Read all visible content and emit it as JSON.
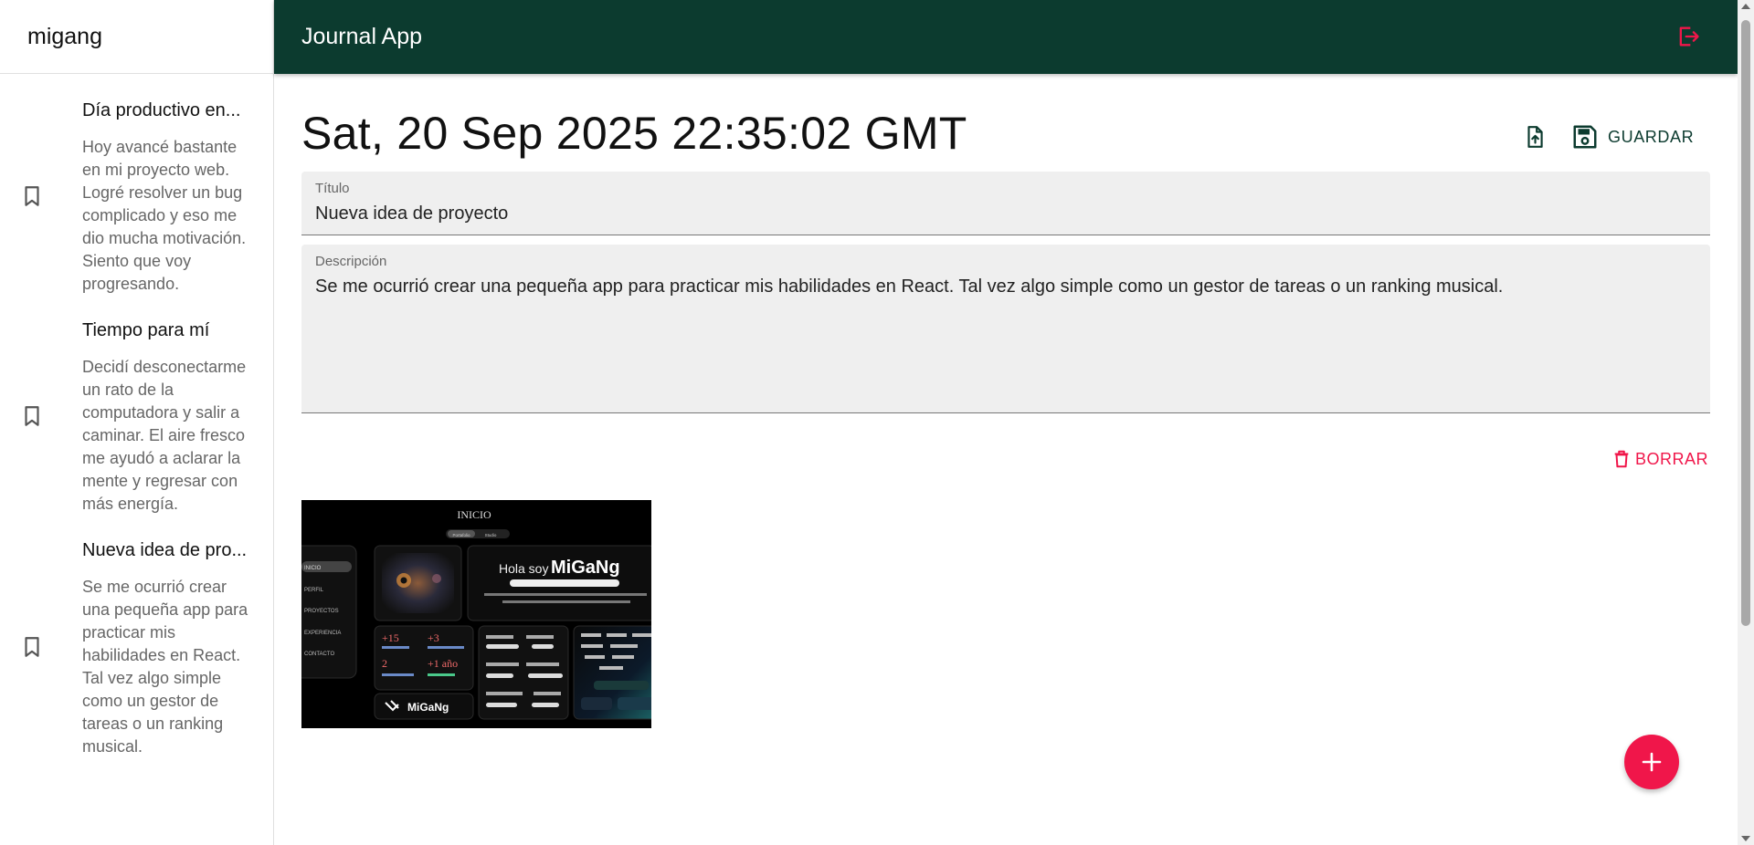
{
  "sidebar": {
    "username": "migang",
    "notes": [
      {
        "title": "Día productivo en...",
        "body": "Hoy avancé bastante en mi proyecto web. Logré resolver un bug complicado y eso me dio mucha motivación. Siento que voy progresando.",
        "icon": "bookmark-icon"
      },
      {
        "title": "Tiempo para mí",
        "body": "Decidí desconectarme un rato de la computadora y salir a caminar. El aire fresco me ayudó a aclarar la mente y regresar con más energía.",
        "icon": "bookmark-icon"
      },
      {
        "title": "Nueva idea de pro...",
        "body": "Se me ocurrió crear una pequeña app para practicar mis habilidades en React. Tal vez algo simple como un gestor de tareas o un ranking musical.",
        "icon": "bookmark-icon"
      }
    ]
  },
  "topbar": {
    "title": "Journal App",
    "logout_icon": "logout-icon"
  },
  "main": {
    "date": "Sat, 20 Sep 2025 22:35:02 GMT",
    "save_label": "GUARDAR",
    "delete_label": "BORRAR",
    "title_field": {
      "label": "Título",
      "value": "Nueva idea de proyecto"
    },
    "description_field": {
      "label": "Descripción",
      "value": "Se me ocurrió crear una pequeña app para practicar mis habilidades en React. Tal vez algo simple como un gestor de tareas o un ranking musical."
    },
    "thumbnail": {
      "heading": "INICIO",
      "tab_1": "Portafolio",
      "tab_2": "Studio",
      "greeting_prefix": "Hola soy",
      "greeting_name": "MiGaNg",
      "menu_items": [
        "INICIO",
        "PERFIL",
        "PROYECTOS",
        "EXPERIENCIA",
        "CONTACTO"
      ],
      "stat_1": "+15",
      "stat_2": "+3",
      "stat_3": "2",
      "stat_4": "+1 año",
      "brand": "MiGaNg"
    }
  },
  "colors": {
    "topbar": "#0c3b2f",
    "accent": "#f0164a",
    "primary": "#0c3b2f"
  }
}
